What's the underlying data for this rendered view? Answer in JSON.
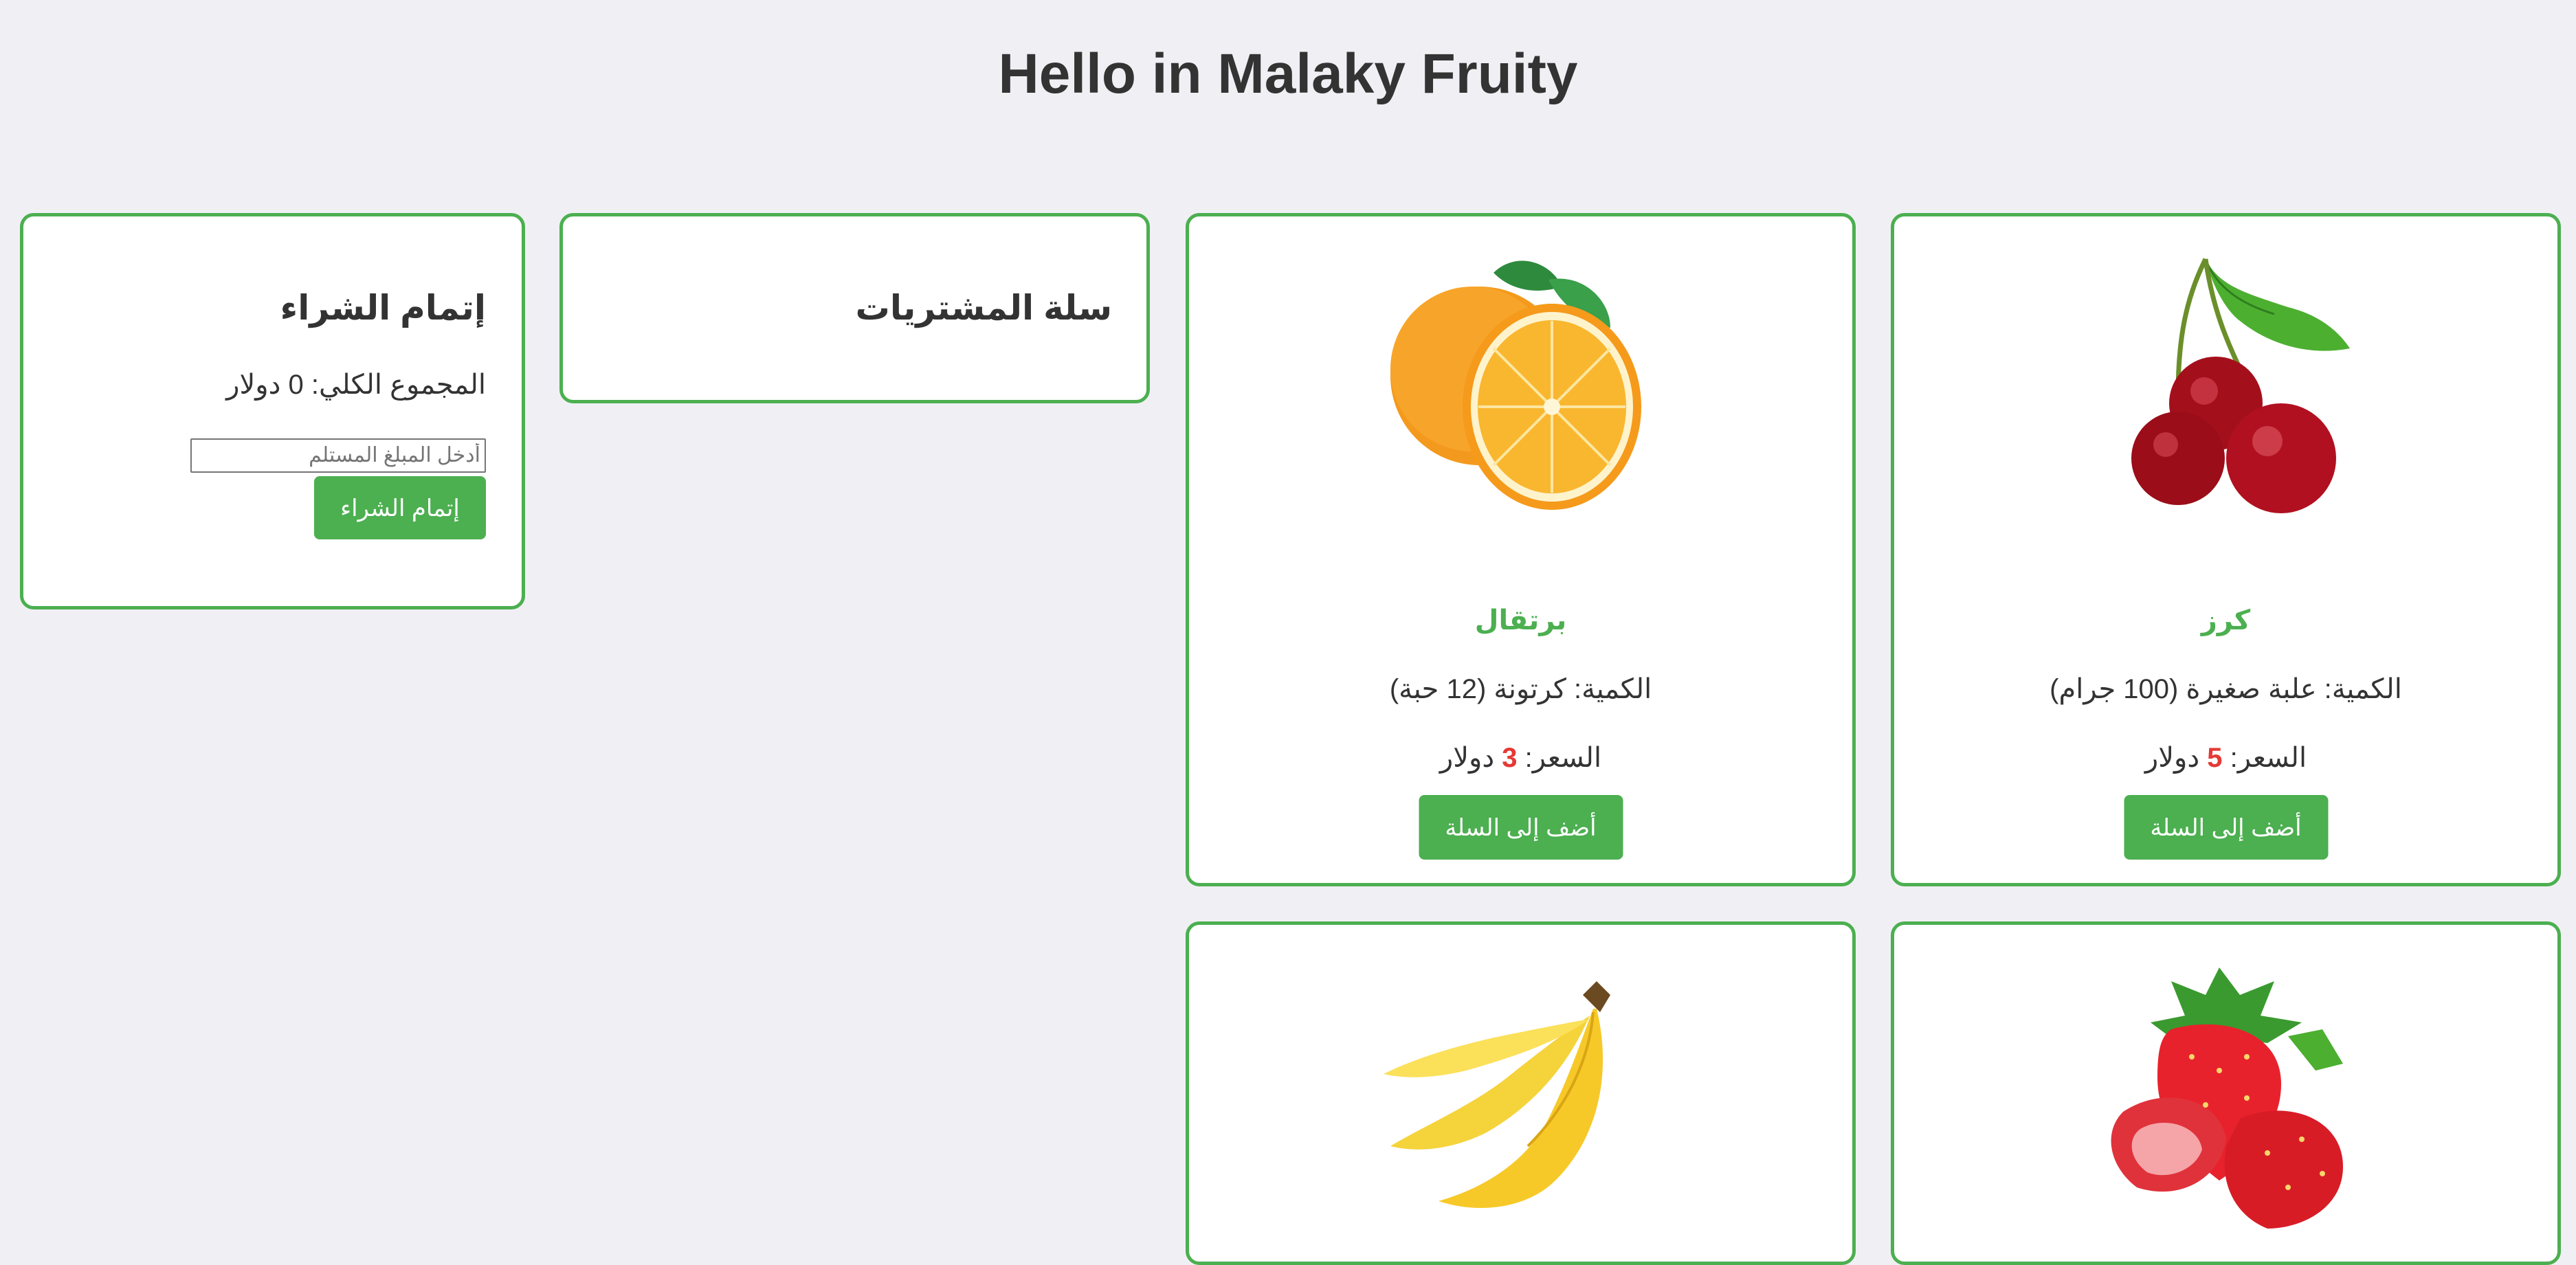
{
  "page": {
    "title": "Hello in Malaky Fruity"
  },
  "checkout": {
    "heading": "إتمام الشراء",
    "total_label": "المجموع الكلي:",
    "total_value": "0",
    "total_currency": "دولار",
    "amount_placeholder": "أدخل المبلغ المستلم",
    "button_label": "إتمام الشراء"
  },
  "cart": {
    "heading": "سلة المشتريات"
  },
  "products": [
    {
      "name": "كرز",
      "quantity": "الكمية: علبة صغيرة (100 جرام)",
      "price_label": "السعر:",
      "price_value": "5",
      "price_currency": "دولار",
      "button_label": "أضف إلى السلة",
      "image": "cherry-image"
    },
    {
      "name": "برتقال",
      "quantity": "الكمية: كرتونة (12 حبة)",
      "price_label": "السعر:",
      "price_value": "3",
      "price_currency": "دولار",
      "button_label": "أضف إلى السلة",
      "image": "orange-image"
    },
    {
      "image": "strawberry-image"
    },
    {
      "image": "banana-image"
    }
  ],
  "colors": {
    "accent": "#4caf50",
    "price": "#e53935",
    "background": "#f0f0f4",
    "text": "#333333"
  }
}
